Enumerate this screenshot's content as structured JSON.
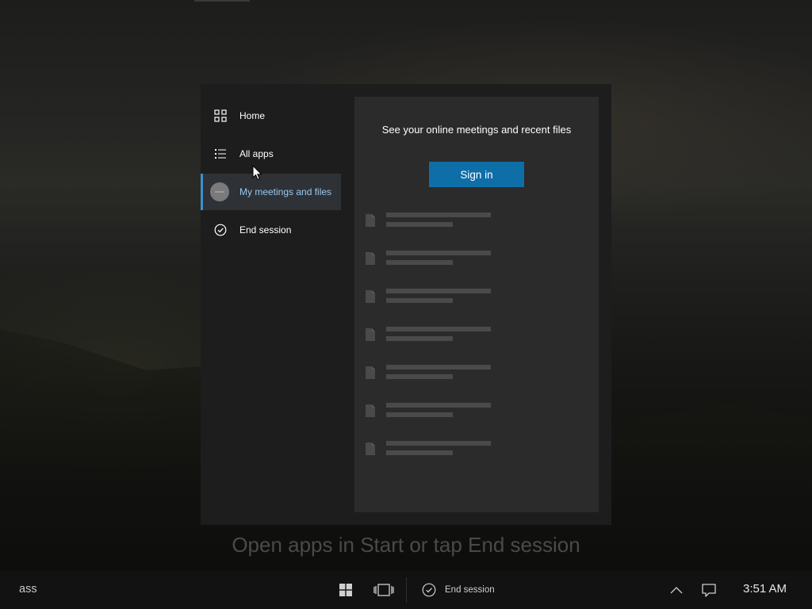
{
  "start_menu": {
    "nav": [
      {
        "label": "Home",
        "icon": "home-icon"
      },
      {
        "label": "All apps",
        "icon": "all-apps-icon"
      },
      {
        "label": "My meetings and files",
        "icon": "avatar"
      },
      {
        "label": "End session",
        "icon": "end-session-icon"
      }
    ],
    "content": {
      "title": "See your online meetings and recent files",
      "sign_in_label": "Sign in"
    }
  },
  "hint": "Open apps in Start or tap End session",
  "taskbar": {
    "search_text": "ass",
    "end_session_label": "End session",
    "clock": "3:51 AM"
  },
  "colors": {
    "accent": "#0e6ea8",
    "active_bar": "#3a8fd0",
    "active_label": "#9ac8ee"
  }
}
